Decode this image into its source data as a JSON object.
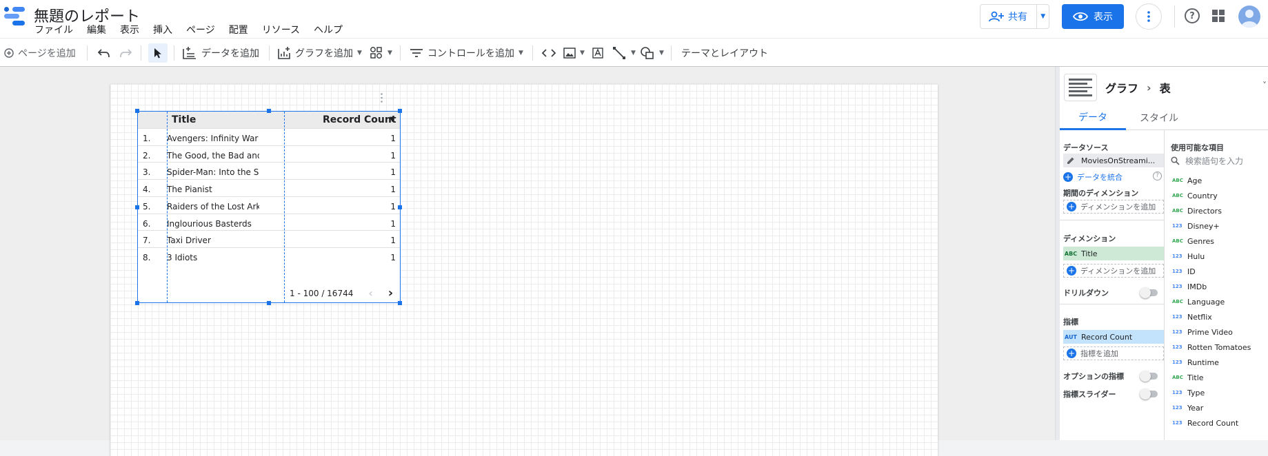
{
  "app": {
    "title": "無題のレポート",
    "menu": [
      "ファイル",
      "編集",
      "表示",
      "挿入",
      "ページ",
      "配置",
      "リソース",
      "ヘルプ"
    ],
    "share_label": "共有",
    "view_label": "表示",
    "help_icon_text": "?"
  },
  "toolbar": {
    "add_page": "ページを追加",
    "add_data": "データを追加",
    "add_chart": "グラフを追加",
    "add_control": "コントロールを追加",
    "theme_layout": "テーマとレイアウト"
  },
  "table": {
    "headers": {
      "title": "Title",
      "metric": "Record Count",
      "sort_icon": "▼"
    },
    "rows": [
      {
        "num": "1.",
        "title": "Avengers: Infinity War",
        "count": "1"
      },
      {
        "num": "2.",
        "title": "The Good, the Bad and the ...",
        "count": "1"
      },
      {
        "num": "3.",
        "title": "Spider-Man: Into the Spider...",
        "count": "1"
      },
      {
        "num": "4.",
        "title": "The Pianist",
        "count": "1"
      },
      {
        "num": "5.",
        "title": "Raiders of the Lost Ark",
        "count": "1"
      },
      {
        "num": "6.",
        "title": "Inglourious Basterds",
        "count": "1"
      },
      {
        "num": "7.",
        "title": "Taxi Driver",
        "count": "1"
      },
      {
        "num": "8.",
        "title": "3 Idiots",
        "count": "1"
      }
    ],
    "pagination": "1 - 100 / 16744"
  },
  "panel": {
    "breadcrumb_root": "グラフ",
    "breadcrumb_sep": "›",
    "breadcrumb_leaf": "表",
    "tabs": {
      "data": "データ",
      "style": "スタイル"
    },
    "data_source_label": "データソース",
    "data_source_name": "MoviesOnStreami...",
    "blend_data": "データを統合",
    "date_dimension_label": "期間のディメンション",
    "add_dimension": "ディメンションを追加",
    "dimension_label": "ディメンション",
    "dimension_tag": "ABC",
    "dimension_value": "Title",
    "drilldown_label": "ドリルダウン",
    "metric_label": "指標",
    "metric_tag": "AUT",
    "metric_value": "Record Count",
    "add_metric": "指標を追加",
    "optional_metric_label": "オプションの指標",
    "metric_slider_label": "指標スライダー",
    "available_fields_label": "使用可能な項目",
    "search_placeholder": "検索語句を入力",
    "fields": [
      {
        "type": "ABC",
        "name": "Age"
      },
      {
        "type": "ABC",
        "name": "Country"
      },
      {
        "type": "ABC",
        "name": "Directors"
      },
      {
        "type": "123",
        "name": "Disney+"
      },
      {
        "type": "ABC",
        "name": "Genres"
      },
      {
        "type": "123",
        "name": "Hulu"
      },
      {
        "type": "123",
        "name": "ID"
      },
      {
        "type": "123",
        "name": "IMDb"
      },
      {
        "type": "ABC",
        "name": "Language"
      },
      {
        "type": "123",
        "name": "Netflix"
      },
      {
        "type": "123",
        "name": "Prime Video"
      },
      {
        "type": "123",
        "name": "Rotten Tomatoes"
      },
      {
        "type": "123",
        "name": "Runtime"
      },
      {
        "type": "ABC",
        "name": "Title"
      },
      {
        "type": "123",
        "name": "Type"
      },
      {
        "type": "123",
        "name": "Year"
      },
      {
        "type": "123",
        "name": "Record Count"
      }
    ]
  },
  "colors": {
    "accent": "#1a73e8",
    "dimension_chip": "#ceead6",
    "metric_chip": "#c2e3fb"
  }
}
